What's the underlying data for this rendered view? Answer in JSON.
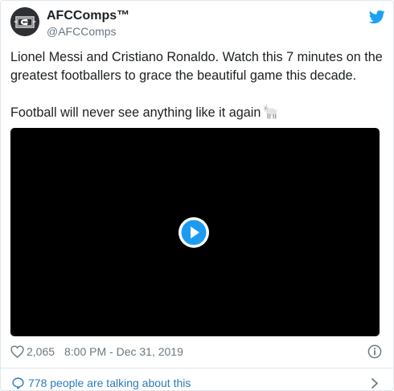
{
  "author": {
    "display_name": "AFCComps™",
    "handle": "@AFCComps"
  },
  "tweet": {
    "text_line1": "Lionel Messi and Cristiano Ronaldo. Watch this 7 minutes on the greatest footballers to grace the beautiful game this decade.",
    "text_line2": "Football will never see anything like it again",
    "emoji": "goat-emoji"
  },
  "media": {
    "type": "video",
    "icon": "play-icon"
  },
  "meta": {
    "likes": "2,065",
    "timestamp": "8:00 PM - Dec 31, 2019",
    "like_icon": "heart-icon",
    "info_icon": "info-icon"
  },
  "footer": {
    "talking_text": "778 people are talking about this",
    "bubble_icon": "speech-bubble-icon",
    "chevron_icon": "chevron-right-icon"
  },
  "colors": {
    "twitter_blue": "#1da1f2",
    "link_blue": "#2b7bb9",
    "muted_gray": "#697882",
    "text": "#1c2022",
    "border": "#e1e8ed"
  }
}
